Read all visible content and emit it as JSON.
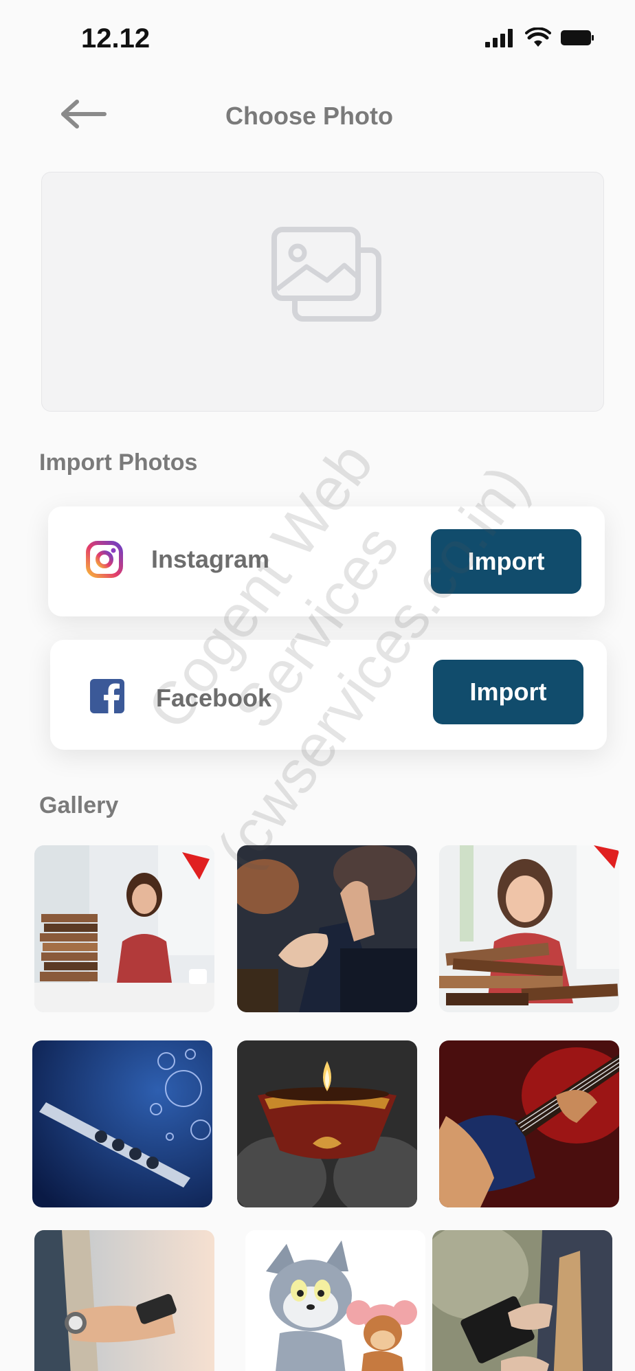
{
  "status_bar": {
    "time": "12.12",
    "icons": [
      "signal-icon",
      "wifi-icon",
      "battery-icon"
    ]
  },
  "header": {
    "title": "Choose Photo",
    "back_icon": "arrow-left-icon"
  },
  "preview": {
    "icon": "image-placeholder-icon"
  },
  "import_section": {
    "title": "Import Photos",
    "sources": [
      {
        "name": "Instagram",
        "icon": "instagram-icon",
        "button": "Import"
      },
      {
        "name": "Facebook",
        "icon": "facebook-icon",
        "button": "Import"
      }
    ]
  },
  "gallery": {
    "title": "Gallery",
    "photos": [
      "student-with-books-photo",
      "audience-clapping-photo",
      "girl-hugging-books-photo",
      "flute-with-bubbles-photo",
      "diya-lamp-photo",
      "guitar-player-photo",
      "man-with-phone-photo",
      "tom-and-jerry-photo",
      "man-with-tablet-photo"
    ]
  },
  "watermark": {
    "line1": "Cogent Web Services",
    "line2": "(cwservices.co.in)"
  },
  "colors": {
    "accent": "#114c6c",
    "background": "#fafafa",
    "text_muted": "#7a7a7a"
  }
}
